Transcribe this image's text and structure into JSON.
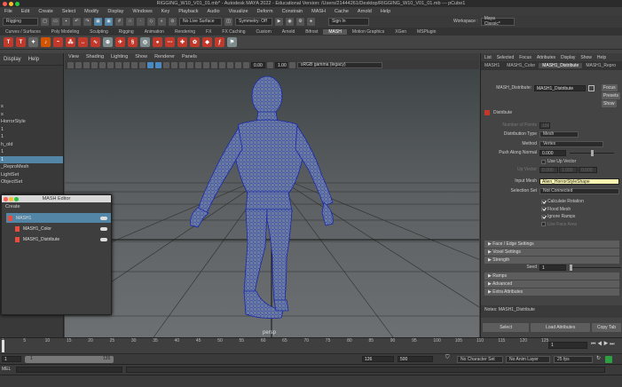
{
  "window_title": "RIGGING_W10_V01_01.mb* - Autodesk MAYA 2022 - Educational Version: /Users/21444261/Desktop/RIGGING_W10_V01_01.mb --- pCube1",
  "menus": [
    "File",
    "Edit",
    "Create",
    "Select",
    "Modify",
    "Display",
    "Windows",
    "Key",
    "Playback",
    "Audio",
    "Visualize",
    "Deform",
    "Constrain",
    "MASH",
    "Cache",
    "Arnold",
    "Help"
  ],
  "status_line": {
    "mode": "Rigging",
    "live_surface": "No Live Surface",
    "symmetry": "Symmetry: Off",
    "sign_in": "Sign In",
    "workspace_label": "Workspace :",
    "workspace_value": "Maya Classic*"
  },
  "shelf_tabs": [
    "Curves / Surfaces",
    "Poly Modeling",
    "Sculpting",
    "Rigging",
    "Animation",
    "Rendering",
    "FX",
    "FX Caching",
    "Custom",
    "Arnold",
    "Bifrost",
    "MASH",
    "Motion Graphics",
    "XGen",
    "MSPlugin"
  ],
  "active_shelf_tab": "MASH",
  "outliner": {
    "header": [
      "Display",
      "Help"
    ],
    "items": [
      "s",
      "s",
      "HorrorStyle",
      "1",
      "1",
      "h_old",
      "1",
      "1",
      "_ReproMesh",
      "LightSet",
      "ObjectSet"
    ],
    "selected_index": 7
  },
  "viewport": {
    "menu": [
      "View",
      "Shading",
      "Lighting",
      "Show",
      "Renderer",
      "Panels"
    ],
    "exposure": "0.00",
    "gamma": "1.00",
    "color_space": "sRGB gamma (legacy)",
    "camera_label": "persp"
  },
  "attribute_editor": {
    "menu": [
      "List",
      "Selected",
      "Focus",
      "Attributes",
      "Display",
      "Show",
      "Help"
    ],
    "tabs": [
      "MASH1",
      "MASH1_Color",
      "MASH1_Distribute",
      "MASH1_Repro"
    ],
    "active_tab": "MASH1_Distribute",
    "node_label": "MASH_Distribute:",
    "node_value": "MASH1_Distribute",
    "side_buttons": [
      "Focus",
      "Presets",
      "Show"
    ],
    "section_title": "Distribute",
    "fields": {
      "number_of_points": {
        "label": "Number of Points",
        "value": "100"
      },
      "distribution_type": {
        "label": "Distribution Type",
        "value": "Mesh"
      },
      "method": {
        "label": "Method",
        "value": "Vertex"
      },
      "push_along_normal": {
        "label": "Push Along Normal",
        "value": "0.000"
      },
      "use_up_vector": "Use Up Vector",
      "up_vector": {
        "label": "Up Vector",
        "values": [
          "0.000",
          "1.000",
          "0.000"
        ]
      },
      "input_mesh": {
        "label": "Input Mesh",
        "value": "Alien_HorrorStyleShape"
      },
      "selection_set": {
        "label": "Selection Set",
        "value": "Not Connected"
      },
      "checks": [
        {
          "label": "Calculate Rotation",
          "on": true
        },
        {
          "label": "Flood Mesh",
          "on": true
        },
        {
          "label": "Ignore Ramps",
          "on": true
        },
        {
          "label": "Use Face Area",
          "on": false
        }
      ]
    },
    "sections": [
      "Face / Edge Settings",
      "Voxel Settings",
      "Strength"
    ],
    "seed": {
      "label": "Seed",
      "value": "1"
    },
    "sections2": [
      "Ramps",
      "Advanced",
      "Extra Attributes"
    ],
    "notes": "Notes:  MASH1_Distribute",
    "buttons": [
      "Select",
      "Load Attributes",
      "Copy Tab"
    ]
  },
  "mash_editor": {
    "title": "MASH Editor",
    "menu": "Create",
    "rows": [
      {
        "label": "MASH1",
        "selected": true
      },
      {
        "label": "MASH1_Color",
        "selected": false
      },
      {
        "label": "MASH1_Distribute",
        "selected": false
      }
    ]
  },
  "timeline": {
    "ticks": [
      "1",
      "5",
      "10",
      "15",
      "20",
      "25",
      "30",
      "35",
      "40",
      "45",
      "50",
      "55",
      "60",
      "65",
      "70",
      "75",
      "80",
      "85",
      "90",
      "95",
      "100",
      "105",
      "110",
      "115",
      "120",
      "125"
    ],
    "current_frame": "1"
  },
  "range": {
    "start": "1",
    "inner_start": "1",
    "inner_end": "126",
    "end": "126",
    "anim_end": "500",
    "character_set": "No Character Set",
    "anim_layer": "No Anim Layer",
    "fps": "25 fps"
  },
  "command_line": {
    "lang": "MEL"
  }
}
